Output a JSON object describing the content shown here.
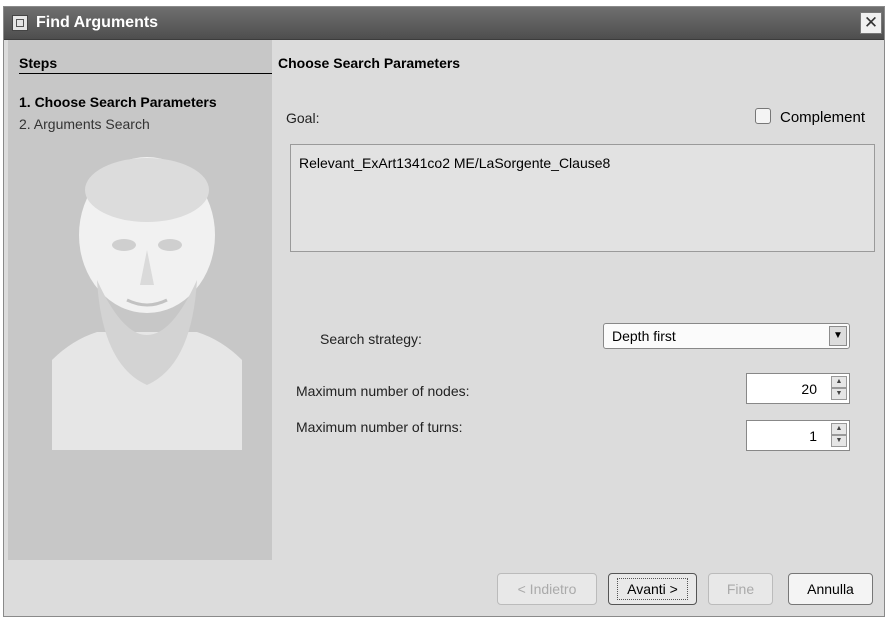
{
  "window": {
    "title": "Find Arguments",
    "close_icon": "close-icon"
  },
  "sidebar": {
    "heading": "Steps",
    "steps": [
      {
        "label": "1. Choose Search Parameters",
        "active": true
      },
      {
        "label": "2. Arguments Search",
        "active": false
      }
    ],
    "image": "philosopher-bust-image"
  },
  "main": {
    "heading": "Choose Search Parameters",
    "goal_label": "Goal:",
    "complement_label": "Complement",
    "complement_checked": false,
    "goal_value": "Relevant_ExArt1341co2 ME/LaSorgente_Clause8",
    "strategy_label": "Search strategy:",
    "strategy_value": "Depth first",
    "max_nodes_label": "Maximum number of nodes:",
    "max_nodes_value": "20",
    "max_turns_label": "Maximum number of turns:",
    "max_turns_value": "1"
  },
  "buttons": {
    "back": "< Indietro",
    "next": "Avanti >",
    "finish": "Fine",
    "cancel": "Annulla"
  }
}
